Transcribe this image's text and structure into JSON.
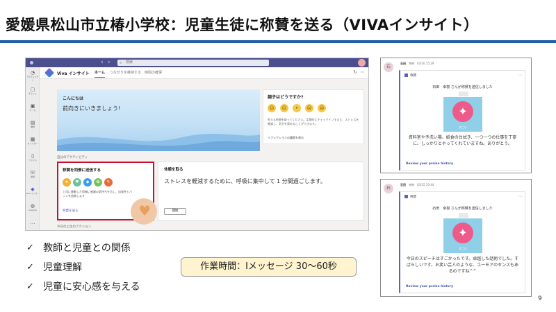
{
  "slide": {
    "title": "愛媛県松山市立椿小学校：児童生徒に称賛を送る（VIVAインサイト）",
    "page_number": "9",
    "accent_color": "#1f5fa8"
  },
  "teams": {
    "search_placeholder": "検索",
    "rail": [
      {
        "label": "アクティビティ",
        "icon": "bell-icon"
      },
      {
        "label": "チャット",
        "icon": "chat-icon"
      },
      {
        "label": "チーム",
        "icon": "teams-icon"
      },
      {
        "label": "課題",
        "icon": "assignment-icon"
      },
      {
        "label": "カレンダー",
        "icon": "calendar-icon"
      },
      {
        "label": "ファイル",
        "icon": "file-icon"
      },
      {
        "label": "通話",
        "icon": "phone-icon"
      },
      {
        "label": "Viva インサ...",
        "icon": "viva-icon"
      },
      {
        "label": "Insights",
        "icon": "insights-icon"
      }
    ],
    "app_name": "Viva インサイト",
    "tabs": [
      "ホーム",
      "つながりを維持する",
      "時間の確保"
    ],
    "hello_card": {
      "title": "こんにちは",
      "body": "前向きにいきましょう!"
    },
    "mood_card": {
      "title": "調子はどうですか?",
      "body": "考える時間を取ってください。定期的にチェックインすると、ストレスを軽減し、気分を高めることができます。",
      "reflection": "リフレクションの履歴を表示"
    },
    "section_label": "自分のアクティビティ",
    "praise_card": {
      "title": "称賛を同僚に送信する",
      "body": "上司に移動した同僚に感謝の気持ちを示し、自発性とバッジを追跡します",
      "link": "称賛を送る"
    },
    "break_card": {
      "title": "休憩を取る",
      "body": "ストレスを軽減するために、呼吸に集中して 1 分間過ごします。",
      "button": "開始"
    },
    "today_label": "今日の上位のアクション"
  },
  "checklist": [
    "教師と児童との関係",
    "児童理解",
    "児童に安心感を与える"
  ],
  "worktime": "作業時間：Ⅰメッセージ 30〜60秒",
  "chats": [
    {
      "avatar": "石",
      "sender": "石田",
      "name2": "幸樹",
      "timestamp": "03/16 15:29",
      "app": "称賛",
      "sent_line": "石田　幸樹 さんが称賛を送信しました",
      "badge_label": "すごい",
      "message": "資料室や予洗い場、給食の台拭き、一つ一つの仕事を丁寧に、しっかりとやってくれていますね。ありがとう。",
      "link": "Review your praise history"
    },
    {
      "avatar": "石",
      "sender": "石田",
      "name2": "幸樹",
      "timestamp": "03/15 10:44",
      "app": "称賛",
      "sent_line": "石田　幸樹 さんが称賛を送信しました",
      "badge_label": "すごい",
      "message": "今日のスピーチはすごかったです。卓越した話術でした。すばらしいです。お笑い芸人のような、ユーモアのセンスもあるのですね^^",
      "link": "Review your praise history"
    }
  ]
}
